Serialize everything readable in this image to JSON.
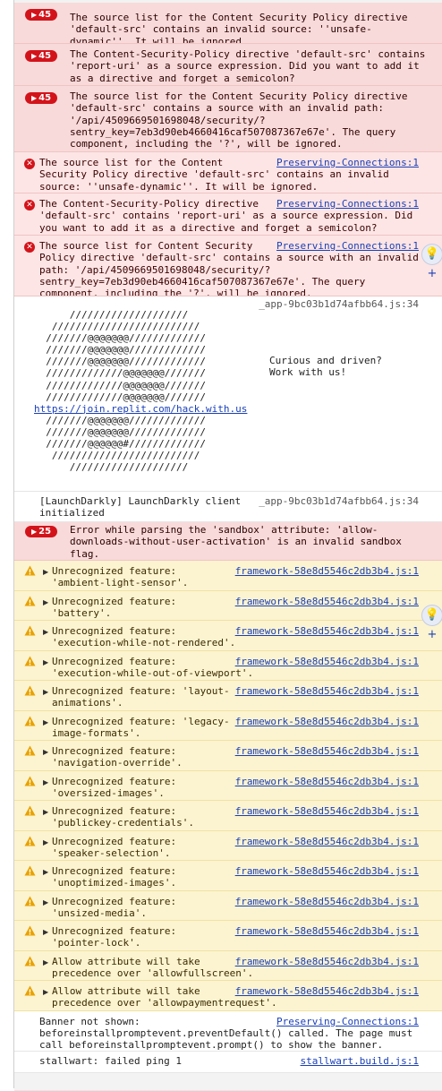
{
  "badge_symbol": "▶",
  "error_icon_glyph": "✕",
  "warning_icon_glyph": "!",
  "expander_glyph": "▶",
  "assist_icon_glyph": "💡+",
  "colors": {
    "error": "#d3131a",
    "warning": "#e8a200",
    "link": "#1a3fb8",
    "error_bg": "#fde5e5",
    "warning_bg": "#fcf4d0"
  },
  "csp_groups": [
    {
      "count": "45",
      "text": "The source list for the Content Security Policy directive\n'default-src' contains an invalid source: ''unsafe-\ndynamic''. It will be ignored."
    },
    {
      "count": "45",
      "text": "The Content-Security-Policy directive 'default-src' contains\n'report-uri' as a source expression. Did you want to add it\nas a directive and forget a semicolon?"
    },
    {
      "count": "45",
      "text": "The source list for the Content Security Policy directive\n'default-src' contains a source with an invalid path:\n'/api/4509669501698048/security/?\nsentry_key=7eb3d90eb4660416caf507087367e67e'. The query\ncomponent, including the '?', will be ignored."
    }
  ],
  "csp_errors": [
    {
      "text": "The source list for the Content         \nSecurity Policy directive 'default-src' contains an invalid\nsource: ''unsafe-dynamic''. It will be ignored.",
      "source": "Preserving-Connections:1"
    },
    {
      "text": "The Content-Security-Policy directive  \n'default-src' contains 'report-uri' as a source expression. Did\nyou want to add it as a directive and forget a semicolon?",
      "source": "Preserving-Connections:1"
    },
    {
      "text": "The source list for Content Security  \nPolicy directive 'default-src' contains a source with an invalid\npath: '/api/4509669501698048/security/?\nsentry_key=7eb3d90eb4660416caf507087367e67e'. The query\ncomponent, including the '?', will be ignored.",
      "source": "Preserving-Connections:1"
    }
  ],
  "ascii_log": {
    "source": "_app-9bc03b1d74afbb64.js:34",
    "art_top": "      ////////////////////\n   /////////////////////////\n  ///////@@@@@@@/////////////\n  ///////@@@@@@@/////////////\n  ///////@@@@@@@/////////////\n  /////////////@@@@@@@///////\n  /////////////@@@@@@@///////\n  /////////////@@@@@@@///////",
    "link": "https://join.replit.com/hack.with.us",
    "art_bottom": "  ///////@@@@@@@/////////////\n  ///////@@@@@@@/////////////\n  ///////@@@@@@#/////////////\n   /////////////////////////\n      ////////////////////",
    "side_text": "Curious and driven?\nWork with us!"
  },
  "launchdarkly": {
    "text": "[LaunchDarkly] LaunchDarkly client\ninitialized",
    "source": "_app-9bc03b1d74afbb64.js:34"
  },
  "sandbox_group": {
    "count": "25",
    "text": "Error while parsing the 'sandbox' attribute: 'allow-\ndownloads-without-user-activation' is an invalid sandbox\nflag."
  },
  "warnings": [
    {
      "text": "Unrecognized feature:\n'ambient-light-sensor'.",
      "source": "framework-58e8d5546c2db3b4.js:1"
    },
    {
      "text": "Unrecognized feature:\n'battery'.",
      "source": "framework-58e8d5546c2db3b4.js:1"
    },
    {
      "text": "Unrecognized feature:\n'execution-while-not-rendered'.",
      "source": "framework-58e8d5546c2db3b4.js:1"
    },
    {
      "text": "Unrecognized feature:\n'execution-while-out-of-viewport'.",
      "source": "framework-58e8d5546c2db3b4.js:1"
    },
    {
      "text": "Unrecognized feature: 'layout-\nanimations'.",
      "source": "framework-58e8d5546c2db3b4.js:1"
    },
    {
      "text": "Unrecognized feature: 'legacy-\nimage-formats'.",
      "source": "framework-58e8d5546c2db3b4.js:1"
    },
    {
      "text": "Unrecognized feature:\n'navigation-override'.",
      "source": "framework-58e8d5546c2db3b4.js:1"
    },
    {
      "text": "Unrecognized feature:\n'oversized-images'.",
      "source": "framework-58e8d5546c2db3b4.js:1"
    },
    {
      "text": "Unrecognized feature:\n'publickey-credentials'.",
      "source": "framework-58e8d5546c2db3b4.js:1"
    },
    {
      "text": "Unrecognized feature:\n'speaker-selection'.",
      "source": "framework-58e8d5546c2db3b4.js:1"
    },
    {
      "text": "Unrecognized feature:\n'unoptimized-images'.",
      "source": "framework-58e8d5546c2db3b4.js:1"
    },
    {
      "text": "Unrecognized feature:\n'unsized-media'.",
      "source": "framework-58e8d5546c2db3b4.js:1"
    },
    {
      "text": "Unrecognized feature:\n'pointer-lock'.",
      "source": "framework-58e8d5546c2db3b4.js:1"
    },
    {
      "text": "Allow attribute will take\nprecedence over 'allowfullscreen'.",
      "source": "framework-58e8d5546c2db3b4.js:1"
    },
    {
      "text": "Allow attribute will take\nprecedence over 'allowpaymentrequest'.",
      "source": "framework-58e8d5546c2db3b4.js:1"
    }
  ],
  "banner": {
    "text": "Banner not shown:\nbeforeinstallpromptevent.preventDefault() called. The page must\ncall beforeinstallpromptevent.prompt() to show the banner.",
    "source": "Preserving-Connections:1"
  },
  "stallwart": {
    "text": "stallwart: failed ping 1",
    "source": "stallwart.build.js:1"
  }
}
